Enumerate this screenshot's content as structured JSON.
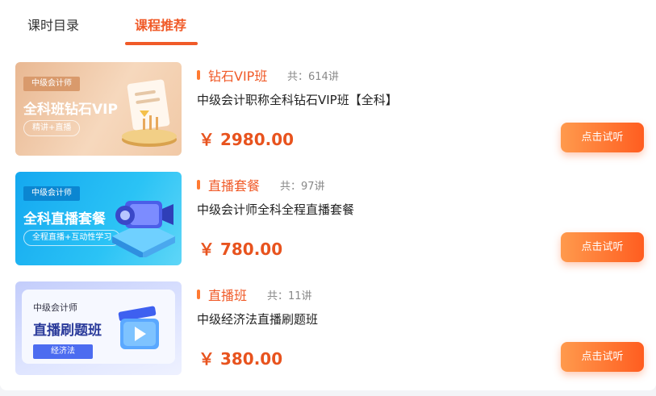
{
  "tabs": [
    {
      "label": "课时目录",
      "active": false
    },
    {
      "label": "课程推荐",
      "active": true
    }
  ],
  "colors": {
    "accent": "#f05a28",
    "price": "#e8531e"
  },
  "courses": [
    {
      "thumb": {
        "badge": "中级会计师",
        "title": "全科班钻石VIP",
        "pill": "精讲+直播",
        "theme": "gold"
      },
      "tag": "钻石VIP班",
      "lessons": "共：614讲",
      "title": "中级会计职称全科钻石VIP班【全科】",
      "price": "￥ 2980.00",
      "button": "点击试听"
    },
    {
      "thumb": {
        "badge": "中级会计师",
        "title": "全科直播套餐",
        "pill": "全程直播+互动性学习",
        "theme": "blue"
      },
      "tag": "直播套餐",
      "lessons": "共：97讲",
      "title": "中级会计师全科全程直播套餐",
      "price": "￥ 780.00",
      "button": "点击试听"
    },
    {
      "thumb": {
        "badge": "中级会计师",
        "title": "直播刷题班",
        "pill": "经济法",
        "theme": "lavender"
      },
      "tag": "直播班",
      "lessons": "共：11讲",
      "title": "中级经济法直播刷题班",
      "price": "￥ 380.00",
      "button": "点击试听"
    }
  ]
}
